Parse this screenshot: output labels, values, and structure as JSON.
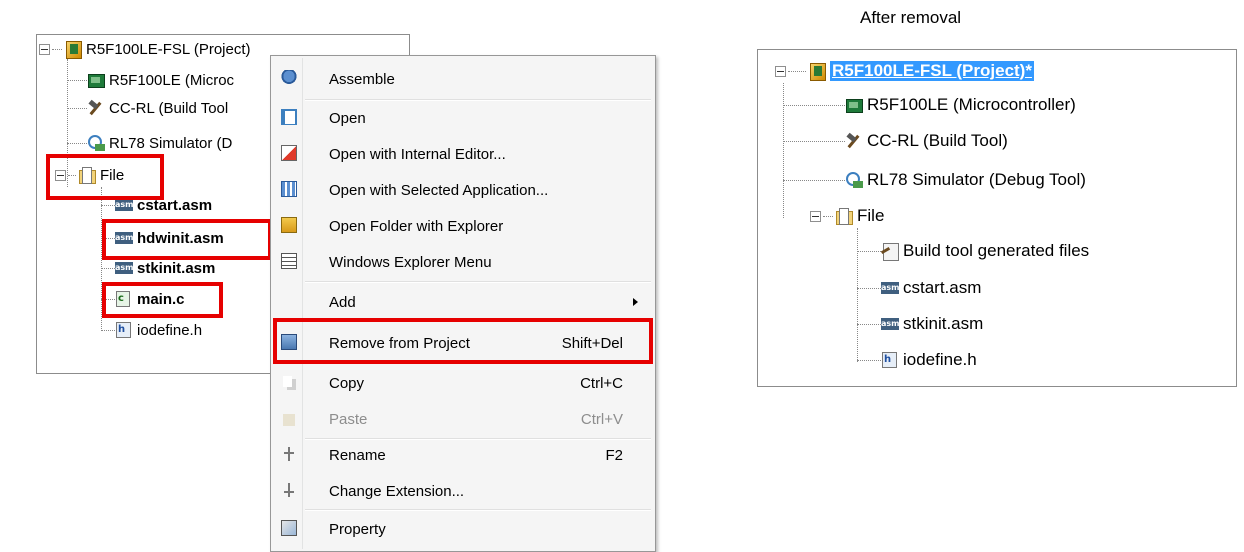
{
  "left_tree": {
    "project": "R5F100LE-FSL (Project)",
    "microcontroller": "R5F100LE (Microc",
    "build_tool": "CC-RL (Build Tool",
    "debug_tool": "RL78 Simulator (D",
    "file_folder": "File",
    "files": [
      "cstart.asm",
      "hdwinit.asm",
      "stkinit.asm",
      "main.c",
      "iodefine.h"
    ]
  },
  "context_menu": {
    "items": [
      {
        "label": "Assemble",
        "shortcut": ""
      },
      {
        "label": "Open",
        "shortcut": ""
      },
      {
        "label": "Open with Internal Editor...",
        "shortcut": ""
      },
      {
        "label": "Open with Selected Application...",
        "shortcut": ""
      },
      {
        "label": "Open Folder with Explorer",
        "shortcut": ""
      },
      {
        "label": "Windows Explorer Menu",
        "shortcut": ""
      },
      {
        "label": "Add",
        "shortcut": ""
      },
      {
        "label": "Remove from Project",
        "shortcut": "Shift+Del"
      },
      {
        "label": "Copy",
        "shortcut": "Ctrl+C"
      },
      {
        "label": "Paste",
        "shortcut": "Ctrl+V"
      },
      {
        "label": "Rename",
        "shortcut": "F2"
      },
      {
        "label": "Change Extension...",
        "shortcut": ""
      },
      {
        "label": "Property",
        "shortcut": ""
      }
    ]
  },
  "after": {
    "caption": "After removal",
    "project": "R5F100LE-FSL (Project)*",
    "microcontroller": "R5F100LE (Microcontroller)",
    "build_tool": "CC-RL (Build Tool)",
    "debug_tool": "RL78 Simulator (Debug Tool)",
    "file_folder": "File",
    "generated": "Build tool generated files",
    "files": [
      "cstart.asm",
      "stkinit.asm",
      "iodefine.h"
    ]
  },
  "colors": {
    "highlight_box": "#e60000",
    "selection": "#3399ff"
  }
}
